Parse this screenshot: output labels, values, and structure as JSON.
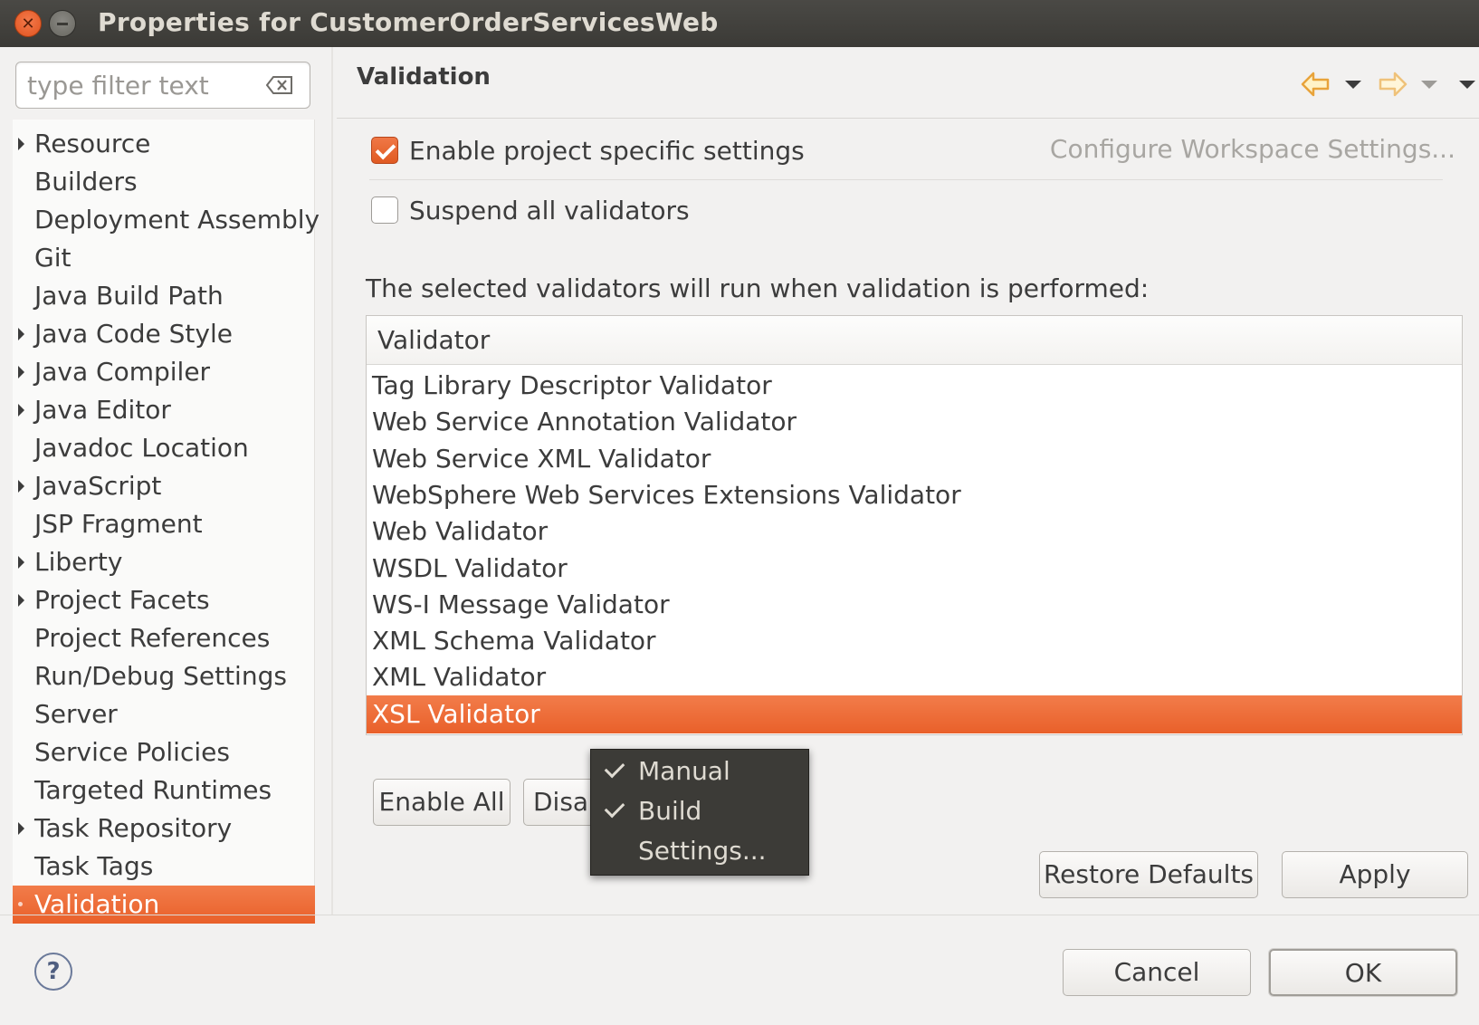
{
  "window": {
    "title": "Properties for CustomerOrderServicesWeb"
  },
  "filter": {
    "placeholder": "type filter text"
  },
  "tree": {
    "items": [
      {
        "label": "Resource",
        "expandable": true
      },
      {
        "label": "Builders",
        "expandable": false
      },
      {
        "label": "Deployment Assembly",
        "expandable": false
      },
      {
        "label": "Git",
        "expandable": false
      },
      {
        "label": "Java Build Path",
        "expandable": false
      },
      {
        "label": "Java Code Style",
        "expandable": true
      },
      {
        "label": "Java Compiler",
        "expandable": true
      },
      {
        "label": "Java Editor",
        "expandable": true
      },
      {
        "label": "Javadoc Location",
        "expandable": false
      },
      {
        "label": "JavaScript",
        "expandable": true
      },
      {
        "label": "JSP Fragment",
        "expandable": false
      },
      {
        "label": "Liberty",
        "expandable": true
      },
      {
        "label": "Project Facets",
        "expandable": true
      },
      {
        "label": "Project References",
        "expandable": false
      },
      {
        "label": "Run/Debug Settings",
        "expandable": false
      },
      {
        "label": "Server",
        "expandable": false
      },
      {
        "label": "Service Policies",
        "expandable": false
      },
      {
        "label": "Targeted Runtimes",
        "expandable": false
      },
      {
        "label": "Task Repository",
        "expandable": true
      },
      {
        "label": "Task Tags",
        "expandable": false
      },
      {
        "label": "Validation",
        "expandable": false,
        "selected": true
      }
    ]
  },
  "page": {
    "title": "Validation",
    "enable_specific": "Enable project specific settings",
    "enable_specific_checked": true,
    "configure_link": "Configure Workspace Settings...",
    "suspend_all": "Suspend all validators",
    "suspend_all_checked": false,
    "description": "The selected validators will run when validation is performed:"
  },
  "table": {
    "column": "Validator",
    "rows": [
      "Tag Library Descriptor Validator",
      "Web Service Annotation Validator",
      "Web Service XML Validator",
      "WebSphere Web Services Extensions Validator",
      "Web Validator",
      "WSDL Validator",
      "WS-I Message Validator",
      "XML Schema Validator",
      "XML Validator",
      "XSL Validator"
    ],
    "selected_index": 9
  },
  "buttons": {
    "enable_all": "Enable All",
    "disable_all": "Disable All",
    "restore_defaults": "Restore Defaults",
    "apply": "Apply",
    "cancel": "Cancel",
    "ok": "OK"
  },
  "context_menu": {
    "items": [
      {
        "label": "Manual",
        "checked": true
      },
      {
        "label": "Build",
        "checked": true
      },
      {
        "label": "Settings...",
        "checked": false
      }
    ]
  },
  "help": {
    "symbol": "?"
  },
  "colors": {
    "accent": "#e9602a",
    "titlebar": "#3b3a36",
    "menu_bg": "#3c3b37",
    "nav_arrow": "#e8a33a"
  },
  "icons": {
    "close": "close-icon",
    "minimize": "minimize-icon",
    "clear": "clear-filter-icon",
    "back": "back-arrow-icon",
    "forward": "forward-arrow-icon",
    "menu": "view-menu-icon",
    "help": "help-icon"
  }
}
